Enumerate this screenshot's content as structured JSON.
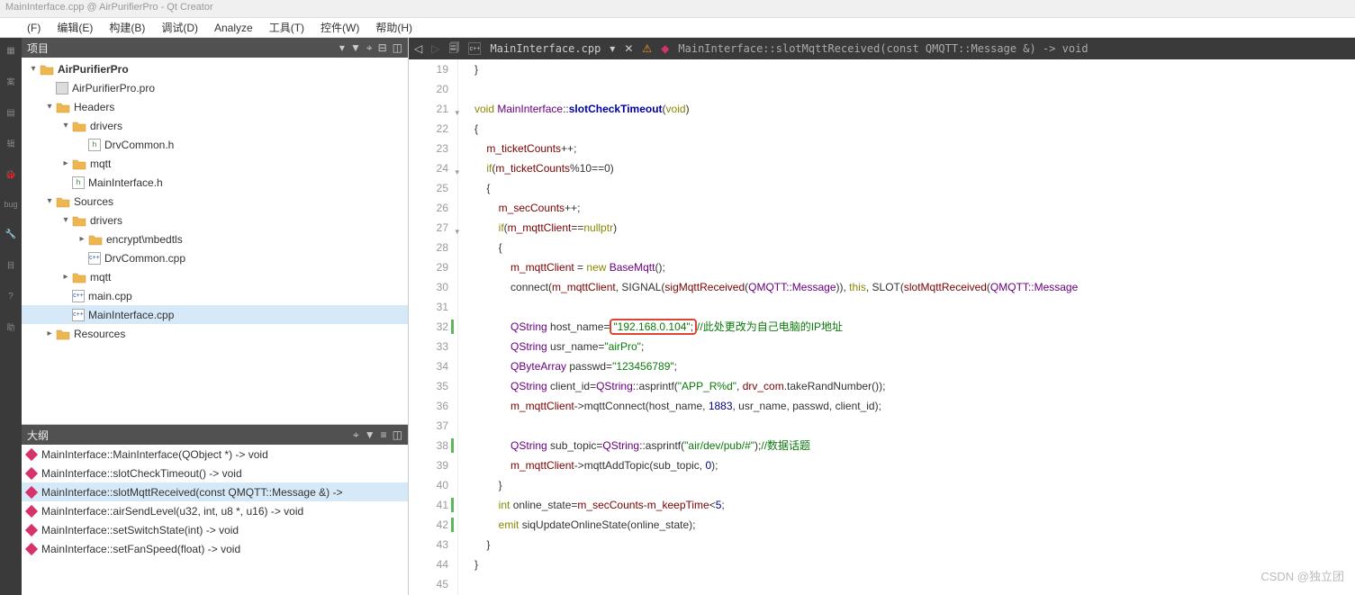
{
  "window": {
    "title": "MainInterface.cpp @ AirPurifierPro - Qt Creator"
  },
  "menus": [
    "(F)",
    "编辑(E)",
    "构建(B)",
    "调试(D)",
    "Analyze",
    "工具(T)",
    "控件(W)",
    "帮助(H)"
  ],
  "activity": [
    {
      "icon": "▦",
      "label": "案"
    },
    {
      "icon": "▤",
      "label": "辑"
    },
    {
      "icon": "🐞",
      "label": "bug"
    },
    {
      "icon": "🔧",
      "label": "目"
    },
    {
      "icon": "?",
      "label": "助"
    }
  ],
  "panels": {
    "project": "项目",
    "outline": "大纲"
  },
  "tree": [
    {
      "depth": 0,
      "exp": "▾",
      "icon": "folder",
      "label": "AirPurifierPro",
      "bold": true
    },
    {
      "depth": 1,
      "exp": "",
      "icon": "pro",
      "label": "AirPurifierPro.pro"
    },
    {
      "depth": 1,
      "exp": "▾",
      "icon": "folder",
      "label": "Headers"
    },
    {
      "depth": 2,
      "exp": "▾",
      "icon": "folder",
      "label": "drivers"
    },
    {
      "depth": 3,
      "exp": "",
      "icon": "h",
      "label": "DrvCommon.h"
    },
    {
      "depth": 2,
      "exp": "▸",
      "icon": "folder",
      "label": "mqtt"
    },
    {
      "depth": 2,
      "exp": "",
      "icon": "h",
      "label": "MainInterface.h"
    },
    {
      "depth": 1,
      "exp": "▾",
      "icon": "folder",
      "label": "Sources"
    },
    {
      "depth": 2,
      "exp": "▾",
      "icon": "folder",
      "label": "drivers"
    },
    {
      "depth": 3,
      "exp": "▸",
      "icon": "folder",
      "label": "encrypt\\mbedtls"
    },
    {
      "depth": 3,
      "exp": "",
      "icon": "cpp",
      "label": "DrvCommon.cpp"
    },
    {
      "depth": 2,
      "exp": "▸",
      "icon": "folder",
      "label": "mqtt"
    },
    {
      "depth": 2,
      "exp": "",
      "icon": "cpp",
      "label": "main.cpp"
    },
    {
      "depth": 2,
      "exp": "",
      "icon": "cpp",
      "label": "MainInterface.cpp",
      "selected": true
    },
    {
      "depth": 1,
      "exp": "▸",
      "icon": "folder",
      "label": "Resources"
    }
  ],
  "outline_items": [
    {
      "label": "MainInterface::MainInterface(QObject *) -> void"
    },
    {
      "label": "MainInterface::slotCheckTimeout() -> void"
    },
    {
      "label": "MainInterface::slotMqttReceived(const QMQTT::Message &) ->",
      "selected": true
    },
    {
      "label": "MainInterface::airSendLevel(u32, int, u8 *, u16) -> void"
    },
    {
      "label": "MainInterface::setSwitchState(int) -> void"
    },
    {
      "label": "MainInterface::setFanSpeed(float) -> void"
    }
  ],
  "breadcrumb": {
    "file": "MainInterface.cpp",
    "signature": "MainInterface::slotMqttReceived(const QMQTT::Message &) -> void"
  },
  "code": {
    "start": 19,
    "lines": [
      {
        "n": 19,
        "raw": "}"
      },
      {
        "n": 20,
        "raw": ""
      },
      {
        "n": 21,
        "fold": "▾",
        "sig": true
      },
      {
        "n": 22,
        "raw": "{"
      },
      {
        "n": 23,
        "t": "tickplus"
      },
      {
        "n": 24,
        "fold": "▾",
        "t": "if10"
      },
      {
        "n": 25,
        "raw": "    {"
      },
      {
        "n": 26,
        "t": "secplus"
      },
      {
        "n": 27,
        "fold": "▾",
        "t": "ifnull"
      },
      {
        "n": 28,
        "raw": "        {"
      },
      {
        "n": 29,
        "t": "newmqtt"
      },
      {
        "n": 30,
        "t": "connect"
      },
      {
        "n": 31,
        "raw": ""
      },
      {
        "n": 32,
        "mark": true,
        "t": "hostname"
      },
      {
        "n": 33,
        "t": "usrname"
      },
      {
        "n": 34,
        "t": "passwd"
      },
      {
        "n": 35,
        "t": "clientid"
      },
      {
        "n": 36,
        "t": "mqttconnect"
      },
      {
        "n": 37,
        "raw": ""
      },
      {
        "n": 38,
        "mark": true,
        "t": "subtopic"
      },
      {
        "n": 39,
        "t": "addtopic"
      },
      {
        "n": 40,
        "raw": "        }"
      },
      {
        "n": 41,
        "mark": true,
        "t": "online"
      },
      {
        "n": 42,
        "mark": true,
        "t": "emit"
      },
      {
        "n": 43,
        "raw": "    }"
      },
      {
        "n": 44,
        "raw": "}"
      },
      {
        "n": 45,
        "raw": ""
      }
    ],
    "tokens": {
      "sig_void1": "void",
      "sig_cls": "MainInterface",
      "sig_fn": "slotCheckTimeout",
      "sig_void2": "void",
      "m_ticket": "m_ticketCounts",
      "if": "if",
      "m_sec": "m_secCounts",
      "m_mqtt": "m_mqttClient",
      "nullptr": "nullptr",
      "new": "new",
      "BaseMqtt": "BaseMqtt",
      "connect": "connect",
      "SIGNAL": "SIGNAL",
      "sigMqtt": "sigMqttReceived",
      "QMQTTMsg": "QMQTT::Message",
      "this": "this",
      "SLOT": "SLOT",
      "slotMqtt": "slotMqttReceived",
      "QString": "QString",
      "hostname": "host_name",
      "hostval": "\"192.168.0.104\"",
      "hostcmt": "//此处更改为自己电脑的IP地址",
      "usrname": "usr_name",
      "usrval": "\"airPro\"",
      "QByteArray": "QByteArray",
      "passwd": "passwd",
      "passval": "\"123456789\"",
      "clientid": "client_id",
      "asprintf": "asprintf",
      "fmt1": "\"APP_R%d\"",
      "drvcom": "drv_com",
      "takeRand": "takeRandNumber",
      "mqttConnect": "mqttConnect",
      "port": "1883",
      "subtopic": "sub_topic",
      "fmt2": "\"air/dev/pub/#\"",
      "subcmt": "//数据话题",
      "addTopic": "mqttAddTopic",
      "zero": "0",
      "int": "int",
      "online": "online_state",
      "keepTime": "m_keepTime",
      "five": "5",
      "emit": "emit",
      "siqUpdate": "siqUpdateOnlineState"
    }
  },
  "watermark": "CSDN @独立团"
}
